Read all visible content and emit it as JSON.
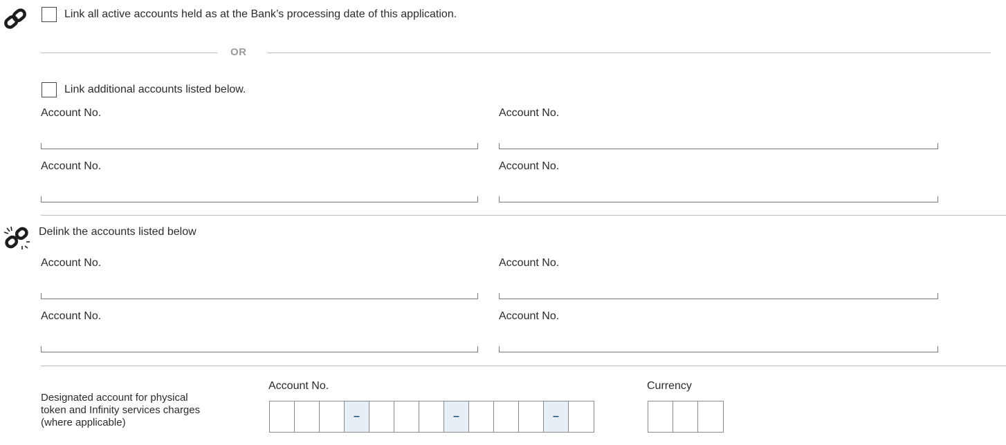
{
  "link_section": {
    "icon": "link-icon",
    "option_all_label": "Link all active accounts held as at the Bank’s processing date of this application.",
    "or_label": "OR",
    "option_additional_label": "Link additional accounts listed below.",
    "fields": [
      "Account No.",
      "Account No.",
      "Account No.",
      "Account No."
    ]
  },
  "delink_section": {
    "icon": "broken-link-icon",
    "title": "Delink the accounts listed below",
    "fields": [
      "Account No.",
      "Account No.",
      "Account No.",
      "Account No."
    ]
  },
  "designated_section": {
    "description": "Designated account for physical token and Infinity services charges (where applicable)",
    "account_label": "Account No.",
    "account_cells": [
      "",
      "",
      "",
      "–",
      "",
      "",
      "",
      "–",
      "",
      "",
      "",
      "–",
      ""
    ],
    "currency_label": "Currency",
    "currency_cells": [
      "",
      "",
      ""
    ]
  },
  "colors": {
    "accent_dash": "#1a4c86",
    "dash_cell_bg": "#e6eef6"
  }
}
